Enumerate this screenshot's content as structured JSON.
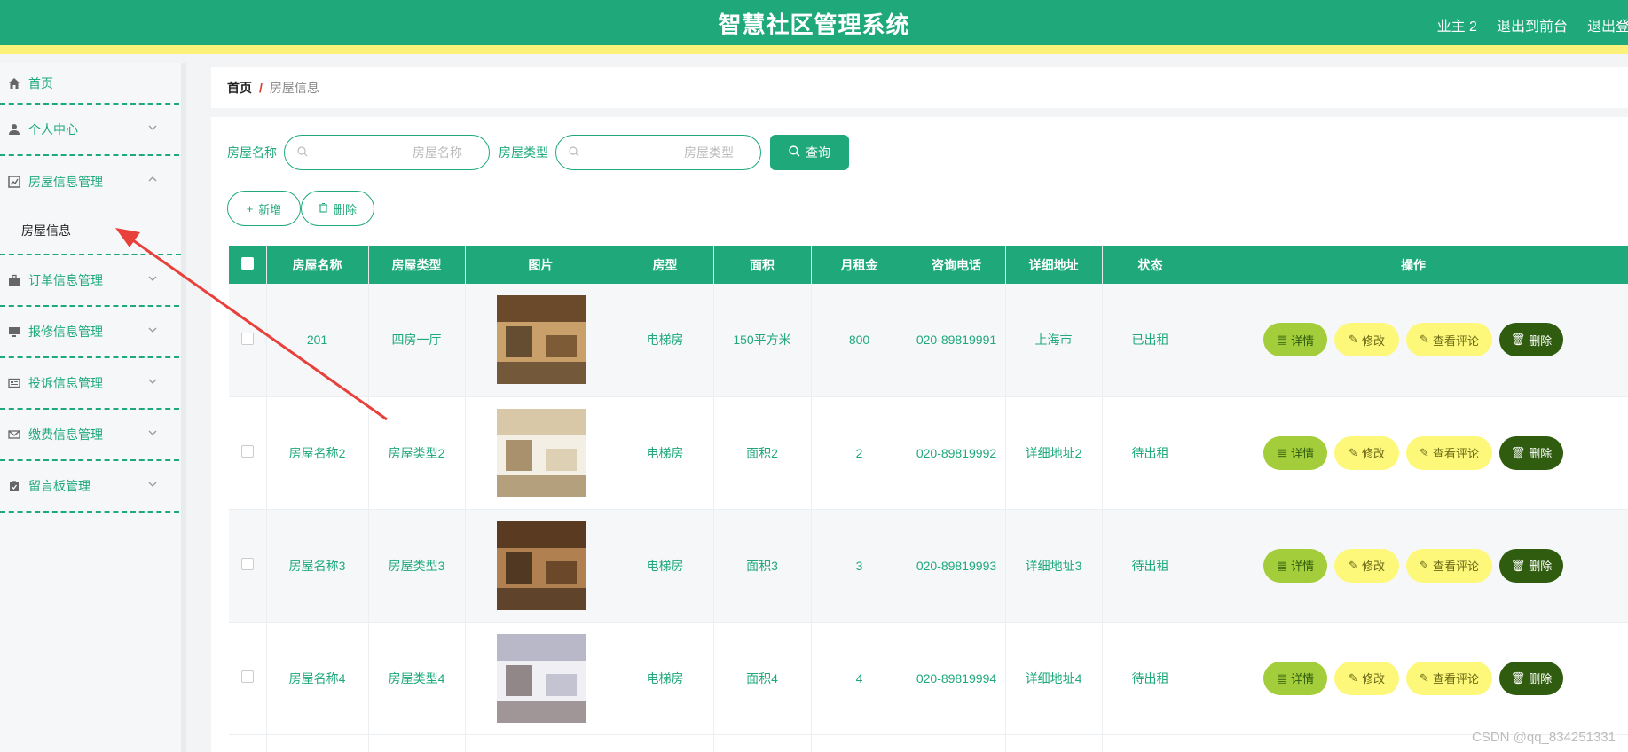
{
  "header": {
    "title": "智慧社区管理系统",
    "user_label": "业主 2",
    "front_link": "退出到前台",
    "logout_link": "退出登录"
  },
  "sidebar": {
    "items": [
      {
        "label": "首页",
        "icon": "home-icon"
      },
      {
        "label": "个人中心",
        "icon": "user-icon"
      },
      {
        "label": "房屋信息管理",
        "icon": "chart-icon",
        "expanded": true,
        "children": [
          {
            "label": "房屋信息"
          }
        ]
      },
      {
        "label": "订单信息管理",
        "icon": "briefcase-icon"
      },
      {
        "label": "报修信息管理",
        "icon": "monitor-icon"
      },
      {
        "label": "投诉信息管理",
        "icon": "card-icon"
      },
      {
        "label": "缴费信息管理",
        "icon": "mail-icon"
      },
      {
        "label": "留言板管理",
        "icon": "clipboard-icon"
      }
    ]
  },
  "breadcrumb": {
    "home": "首页",
    "separator": "/",
    "current": "房屋信息"
  },
  "search": {
    "name_label": "房屋名称",
    "name_placeholder": "房屋名称",
    "type_label": "房屋类型",
    "type_placeholder": "房屋类型",
    "query_label": "查询"
  },
  "actions": {
    "add_label": "新增",
    "delete_label": "删除"
  },
  "table": {
    "headers": [
      "房屋名称",
      "房屋类型",
      "图片",
      "房型",
      "面积",
      "月租金",
      "咨询电话",
      "详细地址",
      "状态",
      "操作"
    ],
    "rows": [
      {
        "name": "201",
        "type": "四房一厅",
        "style": "电梯房",
        "area": "150平方米",
        "rent": "800",
        "phone": "020-89819991",
        "address": "上海市",
        "status": "已出租"
      },
      {
        "name": "房屋名称2",
        "type": "房屋类型2",
        "style": "电梯房",
        "area": "面积2",
        "rent": "2",
        "phone": "020-89819992",
        "address": "详细地址2",
        "status": "待出租"
      },
      {
        "name": "房屋名称3",
        "type": "房屋类型3",
        "style": "电梯房",
        "area": "面积3",
        "rent": "3",
        "phone": "020-89819993",
        "address": "详细地址3",
        "status": "待出租"
      },
      {
        "name": "房屋名称4",
        "type": "房屋类型4",
        "style": "电梯房",
        "area": "面积4",
        "rent": "4",
        "phone": "020-89819994",
        "address": "详细地址4",
        "status": "待出租"
      }
    ],
    "ops": {
      "detail": "详情",
      "edit": "修改",
      "review": "查看评论",
      "delete": "删除"
    }
  },
  "watermark": "CSDN @qq_834251331",
  "colors": {
    "primary": "#1fa97a",
    "header_stripe": "#fcf27a",
    "detail_btn": "#a3cd3a",
    "edit_btn": "#fdf87a",
    "delete_btn": "#2f5c0f",
    "annotation_arrow": "#e8403a"
  }
}
